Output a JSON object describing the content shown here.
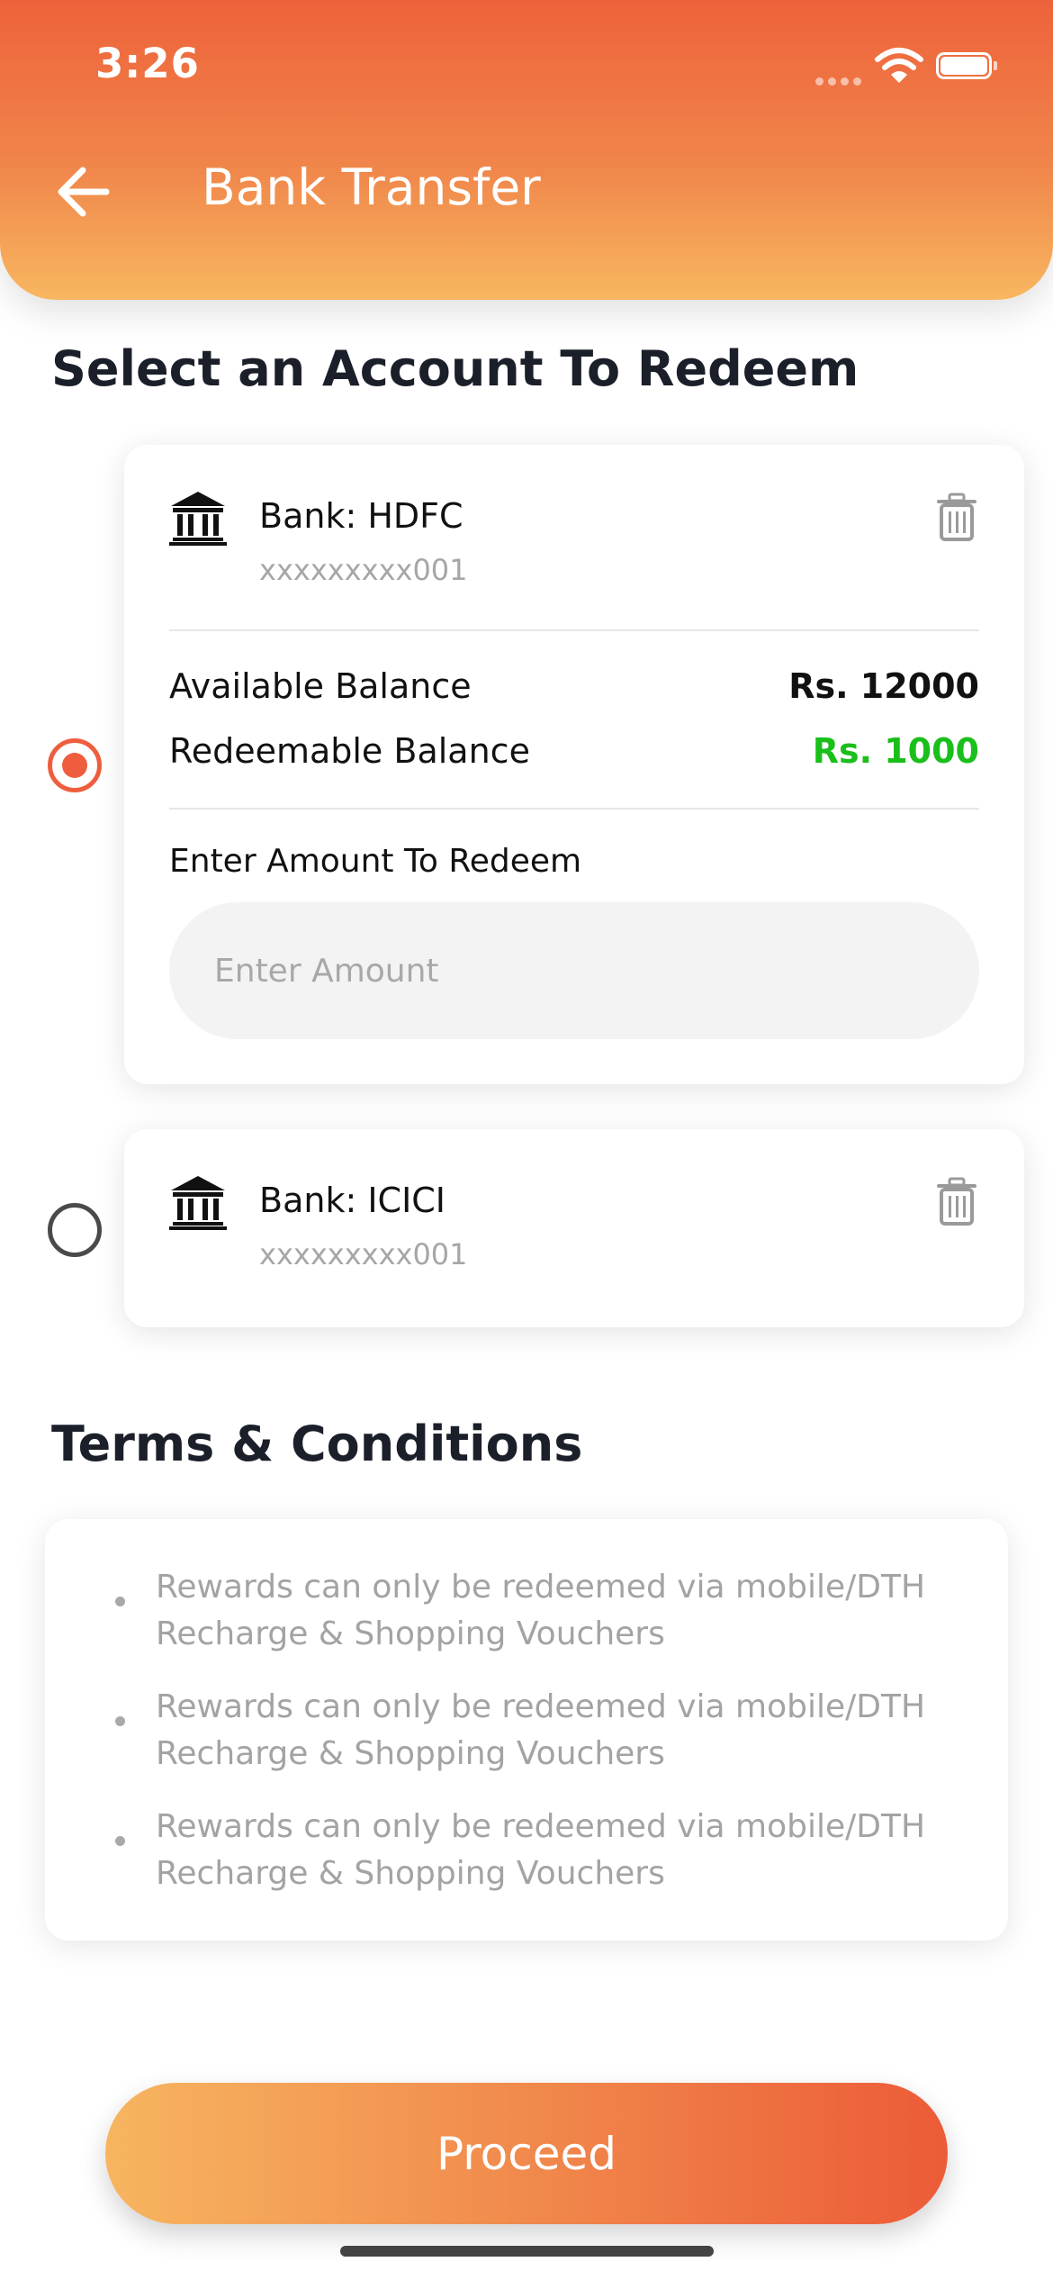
{
  "status_bar": {
    "time": "3:26"
  },
  "header": {
    "title": "Bank Transfer"
  },
  "select_heading": "Select an Account To Redeem",
  "accounts": [
    {
      "bank_label": "Bank: HDFC",
      "account_number": "xxxxxxxxx001",
      "selected": true,
      "available_balance_label": "Available Balance",
      "available_balance_value": "Rs. 12000",
      "redeemable_balance_label": "Redeemable Balance",
      "redeemable_balance_value": "Rs. 1000",
      "amount_label": "Enter Amount To Redeem",
      "amount_placeholder": "Enter Amount",
      "amount_value": ""
    },
    {
      "bank_label": "Bank: ICICI",
      "account_number": "xxxxxxxxx001",
      "selected": false
    }
  ],
  "terms": {
    "heading": "Terms & Conditions",
    "items": [
      "Rewards can only be redeemed via mobile/DTH Recharge & Shopping Vouchers",
      "Rewards can only be redeemed via mobile/DTH Recharge & Shopping Vouchers",
      "Rewards can only be redeemed via mobile/DTH Recharge & Shopping Vouchers"
    ]
  },
  "proceed_label": "Proceed",
  "colors": {
    "accent_orange": "#ee5e3e",
    "gradient_light": "#f8b760",
    "redeemable_green": "#1bbf1b",
    "text_dark": "#1b1f2a",
    "muted_gray": "#a3a3a3"
  },
  "icons": {
    "back": "arrow-left-icon",
    "bank": "bank-building-icon",
    "delete": "trash-icon",
    "wifi": "wifi-icon",
    "battery": "battery-icon"
  }
}
